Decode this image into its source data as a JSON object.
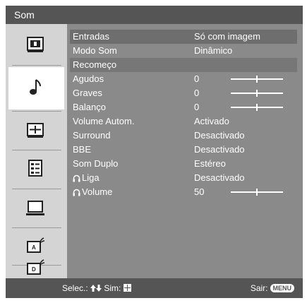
{
  "title": "Som",
  "sidebar": {
    "items": [
      {
        "icon": "picture-icon"
      },
      {
        "icon": "music-note-icon",
        "selected": true
      },
      {
        "icon": "screen-adjust-icon"
      },
      {
        "icon": "list-settings-icon"
      },
      {
        "icon": "monitor-icon"
      },
      {
        "icon": "analog-tv-icon"
      },
      {
        "icon": "digital-tv-icon"
      }
    ]
  },
  "menu": {
    "rows": [
      {
        "label": "Entradas",
        "value": "Só com imagem"
      },
      {
        "label": "Modo Som",
        "value": "Dinâmico"
      },
      {
        "label": "Recomeço",
        "value": ""
      },
      {
        "label": "Agudos",
        "value": "0",
        "level": 0.5
      },
      {
        "label": "Graves",
        "value": "0",
        "level": 0.5
      },
      {
        "label": "Balanço",
        "value": "0",
        "level": 0.5
      },
      {
        "label": "Volume Autom.",
        "value": "Activado"
      },
      {
        "label": "Surround",
        "value": "Desactivado"
      },
      {
        "label": "BBE",
        "value": "Desactivado"
      },
      {
        "label": "Som Duplo",
        "value": "Estéreo"
      },
      {
        "label": "Liga",
        "value": "Desactivado",
        "headphone": true
      },
      {
        "label": "Volume",
        "value": "50",
        "headphone": true,
        "level": 0.5
      }
    ]
  },
  "footer": {
    "select_label": "Selec.:",
    "confirm_label": "Sim:",
    "exit_label": "Sair:",
    "menu_key": "MENU"
  }
}
